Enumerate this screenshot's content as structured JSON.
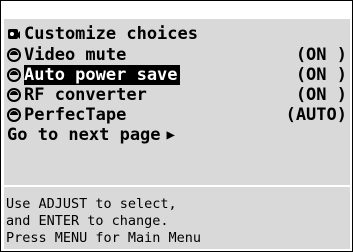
{
  "menu": {
    "title": "Customize choices",
    "title_icon": "camcorder-icon",
    "items": [
      {
        "label": "Video mute",
        "value": "(ON )",
        "icon": "radio-bullet-icon",
        "selected": false
      },
      {
        "label": "Auto power save",
        "value": "(ON )",
        "icon": "radio-bullet-icon",
        "selected": true
      },
      {
        "label": "RF converter",
        "value": "(ON )",
        "icon": "radio-bullet-icon",
        "selected": false
      },
      {
        "label": "PerfecTape",
        "value": "(AUTO)",
        "icon": "radio-bullet-icon",
        "selected": false
      }
    ],
    "next_page": "Go to next page",
    "next_icon": "triangle-right-icon"
  },
  "help": {
    "line1": "Use ADJUST to select,",
    "line2": "and ENTER to change.",
    "line3": "Press MENU for Main Menu"
  },
  "colors": {
    "panel": "#d9d9d9",
    "highlight": "#000000"
  }
}
